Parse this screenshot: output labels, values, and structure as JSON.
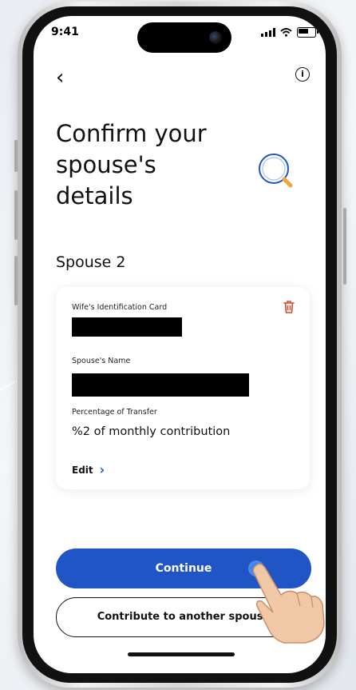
{
  "status_bar": {
    "time": "9:41"
  },
  "header": {
    "back_icon": "chevron-left-icon",
    "info_icon": "info-icon",
    "title": "Confirm your\nspouse's\ndetails"
  },
  "section_title": "Spouse 2",
  "card": {
    "id_label": "Wife's Identification Card",
    "id_value_redacted": true,
    "name_label": "Spouse's Name",
    "name_value_redacted": true,
    "percentage_label": "Percentage of Transfer",
    "percentage_value": "%2 of monthly contribution",
    "edit_label": "Edit",
    "delete_icon": "trash-icon"
  },
  "buttons": {
    "continue_label": "Continue",
    "another_spouse_label": "Contribute to another spouse"
  },
  "colors": {
    "primary": "#1f55c5",
    "accent_blue": "#1e56c6",
    "delete_red": "#d9472b",
    "magnifier_orange": "#f0a640"
  }
}
